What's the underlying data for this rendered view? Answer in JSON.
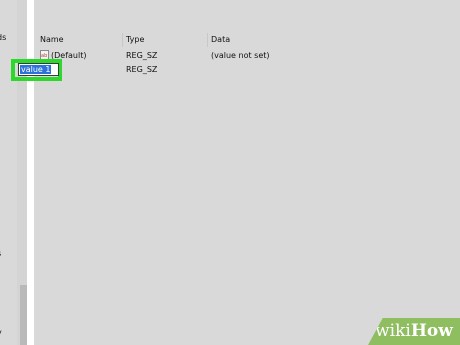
{
  "left_pane": {
    "fragments": [
      "ds",
      "l",
      "s",
      "y"
    ]
  },
  "columns": {
    "name": "Name",
    "type": "Type",
    "data": "Data"
  },
  "rows": [
    {
      "name": "(Default)",
      "type": "REG_SZ",
      "data": "(value not set)"
    },
    {
      "name": "",
      "type": "REG_SZ",
      "data": ""
    }
  ],
  "rename": {
    "value": "value 1"
  },
  "watermark": {
    "prefix": "wiki",
    "suffix": "How"
  },
  "colors": {
    "highlight": "#2bd82b",
    "selection": "#2b73d9",
    "pane_background": "#d9d9d9",
    "watermark": "#8fbe61"
  },
  "icons": [
    "registry-string-value-icon"
  ]
}
